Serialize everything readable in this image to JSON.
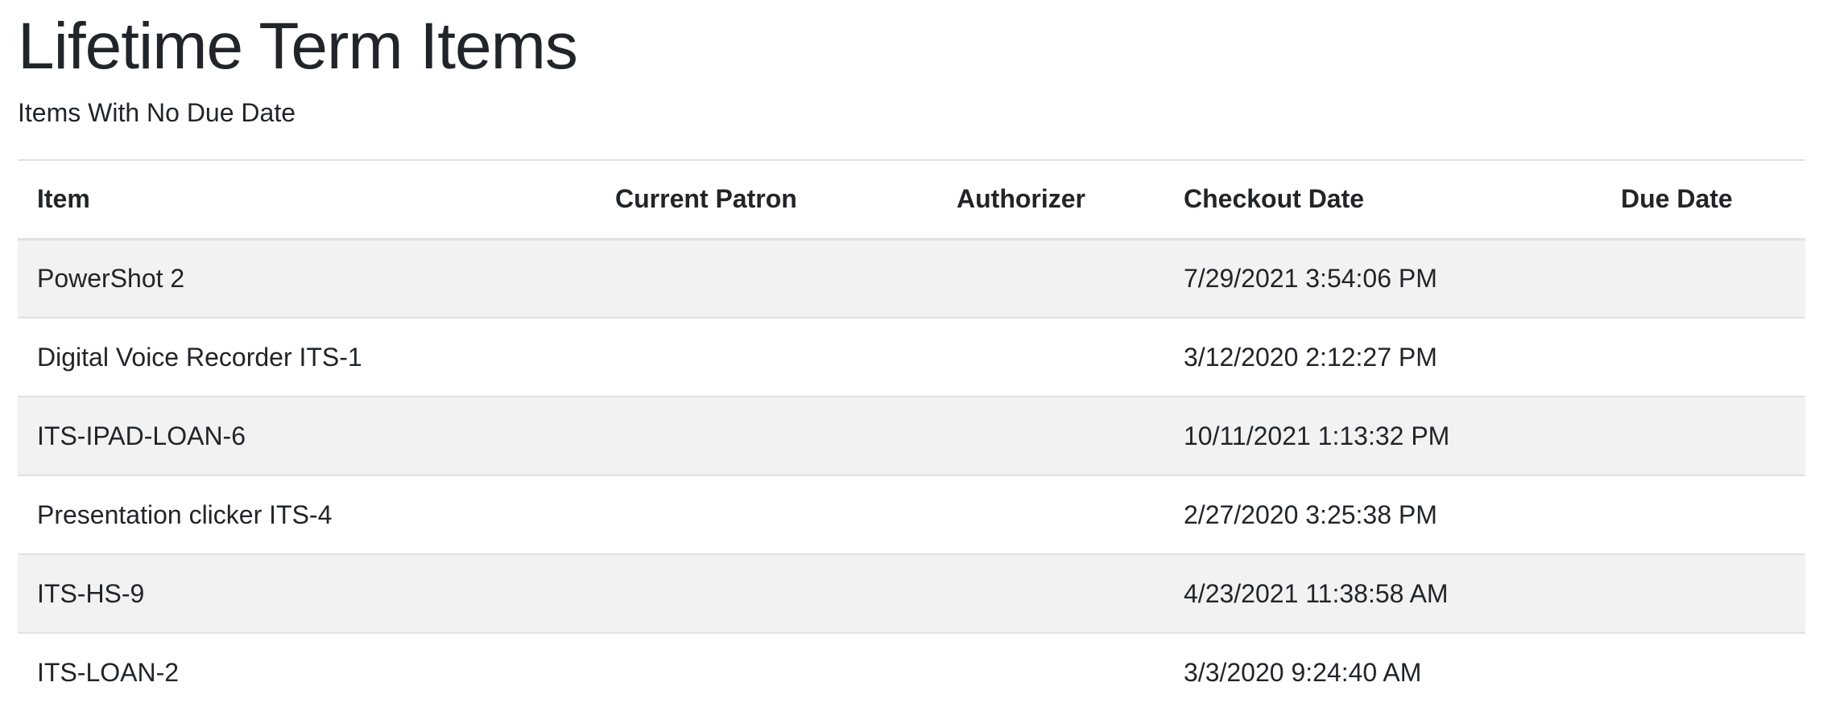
{
  "header": {
    "title": "Lifetime Term Items",
    "subtitle": "Items With No Due Date"
  },
  "table": {
    "columns": [
      "Item",
      "Current Patron",
      "Authorizer",
      "Checkout Date",
      "Due Date"
    ],
    "rows": [
      {
        "item": "PowerShot 2",
        "patron": "",
        "authorizer": "",
        "checkout": "7/29/2021 3:54:06 PM",
        "due": ""
      },
      {
        "item": "Digital Voice Recorder ITS-1",
        "patron": "",
        "authorizer": "",
        "checkout": "3/12/2020 2:12:27 PM",
        "due": ""
      },
      {
        "item": "ITS-IPAD-LOAN-6",
        "patron": "",
        "authorizer": "",
        "checkout": "10/11/2021 1:13:32 PM",
        "due": ""
      },
      {
        "item": "Presentation clicker ITS-4",
        "patron": "",
        "authorizer": "",
        "checkout": "2/27/2020 3:25:38 PM",
        "due": ""
      },
      {
        "item": "ITS-HS-9",
        "patron": "",
        "authorizer": "",
        "checkout": "4/23/2021 11:38:58 AM",
        "due": ""
      },
      {
        "item": "ITS-LOAN-2",
        "patron": "",
        "authorizer": "",
        "checkout": "3/3/2020 9:24:40 AM",
        "due": ""
      }
    ]
  },
  "colors": {
    "text": "#212529",
    "stripe": "#f2f2f2",
    "border": "#dee2e6"
  }
}
